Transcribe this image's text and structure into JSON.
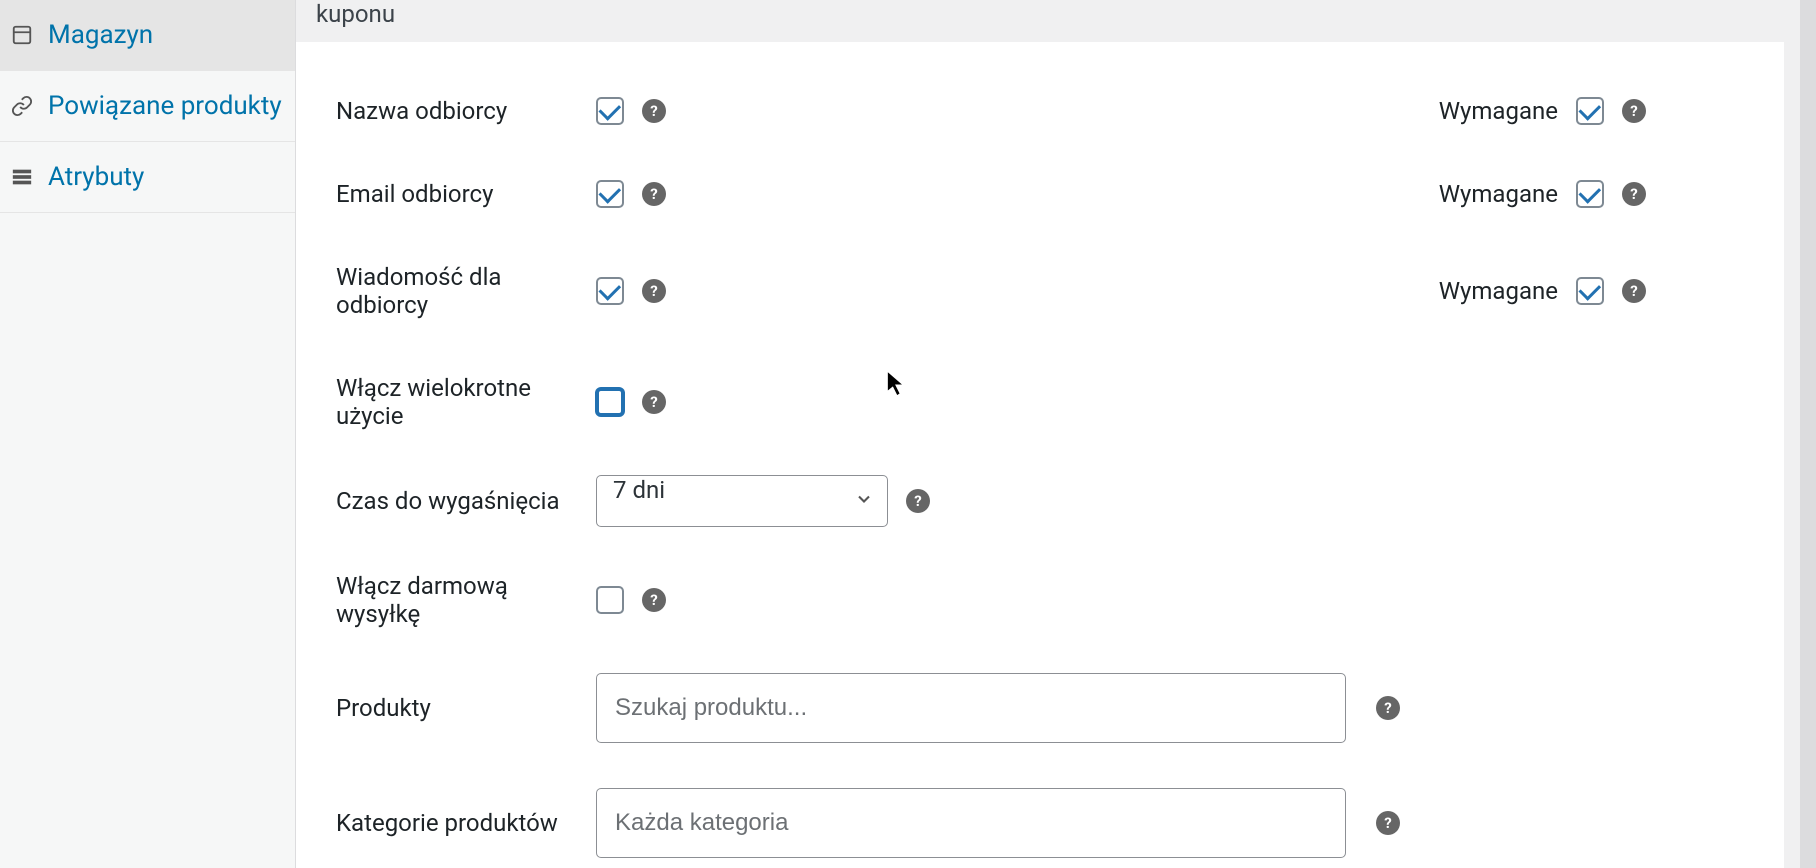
{
  "sidebar": {
    "items": [
      {
        "label": "Magazyn",
        "icon": "inventory"
      },
      {
        "label": "Powiązane produkty",
        "icon": "link"
      },
      {
        "label": "Atrybuty",
        "icon": "attributes"
      }
    ]
  },
  "header": {
    "partial_text": "kuponu"
  },
  "form": {
    "recipient_name": {
      "label": "Nazwa odbiorcy",
      "enabled": true,
      "required_label": "Wymagane",
      "required": true
    },
    "recipient_email": {
      "label": "Email odbiorcy",
      "enabled": true,
      "required_label": "Wymagane",
      "required": true
    },
    "recipient_message": {
      "label": "Wiadomość dla odbiorcy",
      "enabled": true,
      "required_label": "Wymagane",
      "required": true
    },
    "multiple_use": {
      "label": "Włącz wielokrotne użycie",
      "enabled": false
    },
    "expiry": {
      "label": "Czas do wygaśnięcia",
      "value": "7 dni"
    },
    "free_shipping": {
      "label": "Włącz darmową wysyłkę",
      "enabled": false
    },
    "products": {
      "label": "Produkty",
      "placeholder": "Szukaj produktu..."
    },
    "categories": {
      "label": "Kategorie produktów",
      "placeholder": "Każda kategoria"
    }
  }
}
